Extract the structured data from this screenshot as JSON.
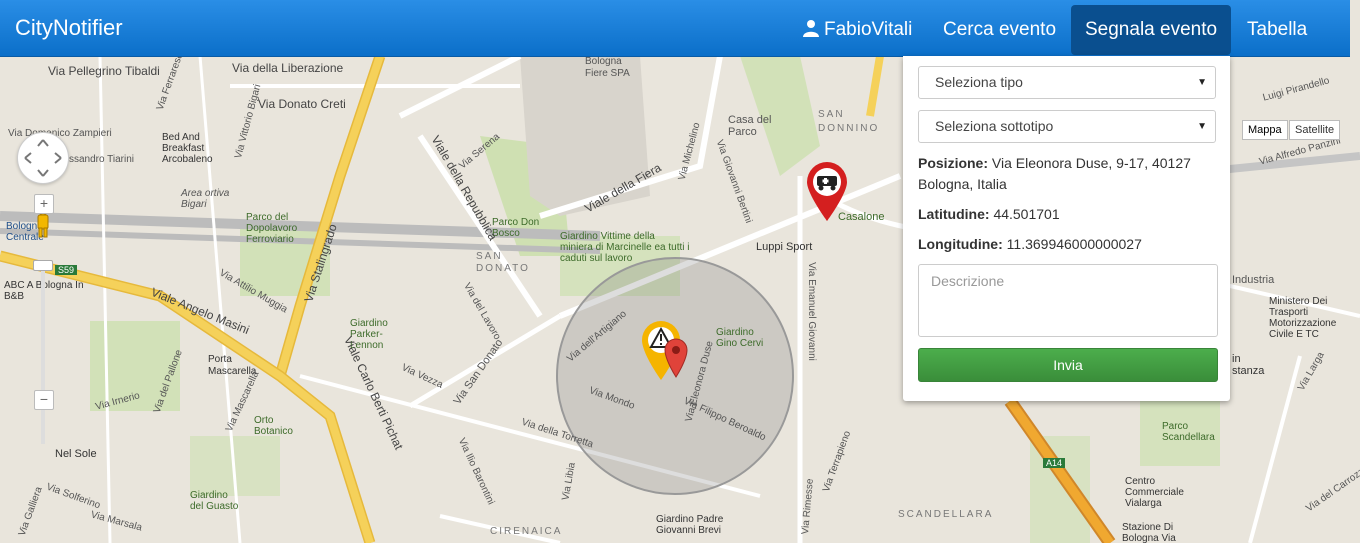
{
  "app": {
    "brand": "CityNotifier"
  },
  "nav": {
    "user": "FabioVitali",
    "search_event": "Cerca evento",
    "report_event": "Segnala evento",
    "table": "Tabella"
  },
  "map_controls": {
    "map": "Mappa",
    "satellite": "Satellite",
    "zoom_in": "+",
    "zoom_out": "−"
  },
  "form": {
    "type_select": "Seleziona tipo",
    "subtype_select": "Seleziona sottotipo",
    "position_label": "Posizione:",
    "position_value": "Via Eleonora Duse, 9-17, 40127 Bologna, Italia",
    "latitude_label": "Latitudine:",
    "latitude_value": "44.501701",
    "longitude_label": "Longitudine:",
    "longitude_value": "11.369946000000027",
    "description_placeholder": "Descrizione",
    "submit": "Invia"
  },
  "map_labels": {
    "pellegrino": "Via Pellegrino Tibaldi",
    "liberazione": "Via della Liberazione",
    "donato_creti": "Via Donato Creti",
    "bologna_fiere": "Bologna Fiere SPA",
    "casa_parco": "Casa del Parco",
    "san_donnino": "SAN DONNINO",
    "bed_breakfast": "Bed And Breakfast Arcobaleno",
    "zampieri": "Via Domenico Zampieri",
    "tiarini": "Via Alessandro Tiarini",
    "bigari": "Area ortiva Bigari",
    "dopolavoro": "Parco del Dopolavoro Ferroviario",
    "parco_don_bosco": "Parco Don Bosco",
    "giardino_marcinelle": "Giardino Vittime della miniera di Marcinelle ea tutti i caduti sul lavoro",
    "luppi_sport": "Luppi Sport",
    "casalone": "Casalone",
    "san_donato_district": "SAN DONATO",
    "bologna_centrale": "Bologna Centrale",
    "abc_bologna": "ABC A Bologna In B&B",
    "angelo_masini": "Viale Angelo Masini",
    "stalingrado": "Via Stalingrado",
    "parker_lennon": "Giardino Parker-Lennon",
    "gino_cervi": "Giardino Gino Cervi",
    "porta_mascarella": "Porta Mascarella",
    "carlo_berti": "Viale Carlo Berti Pichat",
    "orto_botanico": "Orto Botanico",
    "nel_sole": "Nel Sole",
    "giardino_guasto": "Giardino del Guasto",
    "giardino_padre": "Giardino Padre Giovanni Brevi",
    "cirenaica": "CIRENAICA",
    "scandellara": "SCANDELLARA",
    "parco_scandellara": "Parco Scandellara",
    "centro_commerciale": "Centro Commerciale Vialarga",
    "stazione_bologna": "Stazione Di Bologna Via",
    "ministero": "Ministero Dei Trasporti Motorizzazione Civile E TC",
    "industria": "Industria",
    "alfredo_panzini": "Via Alfredo Panzini",
    "pirandello": "Luigi Pirandello",
    "carrozzaio": "Via del Carrozzaio",
    "larga": "Via Larga",
    "in_distanza": "in stanza",
    "viale_fiera": "Viale della Fiera",
    "viale_repubblica": "Viale della Repubblica",
    "via_san_donato": "Via San Donato",
    "via_mondo": "Via Mondo",
    "via_duse": "Via Eleonora Duse",
    "via_beroaldo": "Via Filippo Beroaldo",
    "via_torretta": "Via della Torretta",
    "via_artigiano": "Via dell'Artigiano",
    "via_michelino": "Via Michelino",
    "via_bertini": "Via Giovanni Bertini",
    "via_emanuel": "Via Emanuel Giovanni",
    "via_vezza": "Via Vezza",
    "via_lavoro": "Via del Lavoro",
    "via_serena": "Via Serena",
    "via_ferrarese": "Via Ferrarese",
    "via_bigari": "Via Vittorio Bigari",
    "via_muggia": "Via Attilio Muggia",
    "via_irnerio": "Via Irnerio",
    "via_mascarella": "Via Mascarella",
    "via_pallone": "Via del Pallone",
    "via_solferino": "Via Solferino",
    "via_marsala": "Via Marsala",
    "via_galliera": "Via Galliera",
    "via_ilio_barontini": "Via Ilio Barontini",
    "via_libia": "Via Libia",
    "via_rimesse": "Via Rimesse",
    "via_terrapieno": "Via Terrapieno",
    "s59": "S59",
    "a14": "A14"
  },
  "colors": {
    "nav": "#1a7fdc",
    "submit": "#44a244",
    "motorway": "#f0a830",
    "main_road": "#f5d15a",
    "park": "#c8dfa8"
  }
}
